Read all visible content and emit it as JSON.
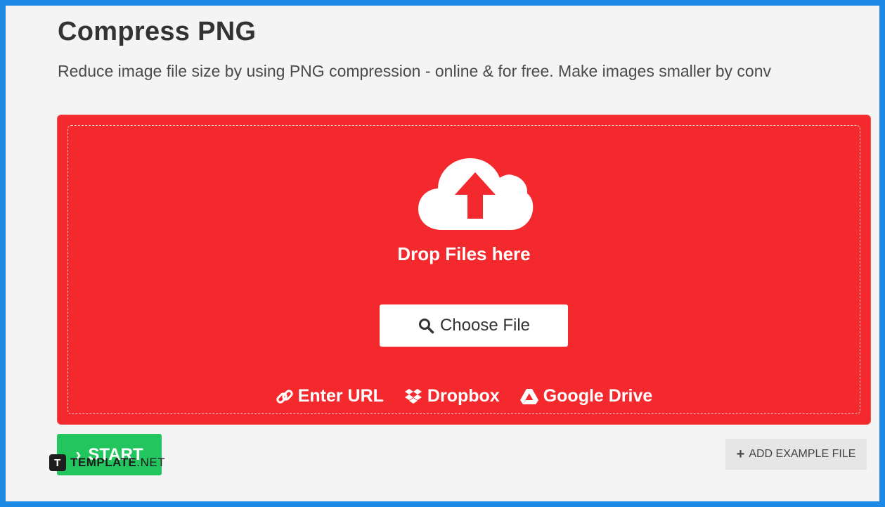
{
  "page": {
    "title": "Compress PNG",
    "subtitle": "Reduce image file size by using PNG compression - online & for free. Make images smaller by conv"
  },
  "dropzone": {
    "icon": "cloud-upload-icon",
    "label": "Drop Files here",
    "choose_file_label": "Choose File",
    "sources": [
      {
        "label": "Enter URL",
        "icon": "link-icon"
      },
      {
        "label": "Dropbox",
        "icon": "dropbox-icon"
      },
      {
        "label": "Google Drive",
        "icon": "google-drive-icon"
      }
    ]
  },
  "actions": {
    "start_label": "START",
    "add_example_label": "ADD EXAMPLE FILE"
  },
  "watermark": {
    "brand": "TEMPLATE",
    "suffix": ".NET",
    "logo_letter": "T"
  },
  "colors": {
    "frame_border": "#1e88e5",
    "dropzone_bg": "#f4292d",
    "start_bg": "#22c55e",
    "page_bg": "#f4f4f4"
  }
}
